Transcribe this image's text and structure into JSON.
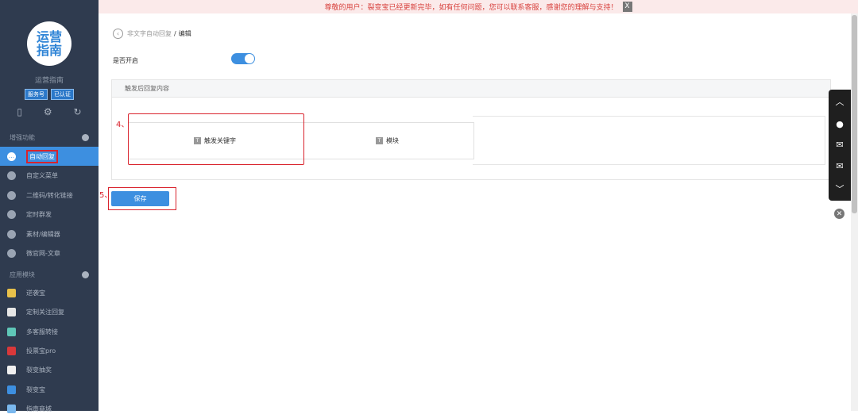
{
  "notice": {
    "text": "尊敬的用户：裂变宝已经更新完毕，如有任何问题，您可以联系客服，感谢您的理解与支持！",
    "close": "X"
  },
  "sidebar": {
    "logo_line1": "运营",
    "logo_line2": "指南",
    "account_name": "运营指南",
    "badges": [
      "服务号",
      "已认证"
    ],
    "section_features": "增强功能",
    "section_apps": "应用模块",
    "items": [
      {
        "label": "自动回复"
      },
      {
        "label": "自定义菜单"
      },
      {
        "label": "二维码/转化链接"
      },
      {
        "label": "定时群发"
      },
      {
        "label": "素材/编辑器"
      },
      {
        "label": "微官网-文章"
      }
    ],
    "apps": [
      {
        "label": "逆袭宝"
      },
      {
        "label": "定制关注回复"
      },
      {
        "label": "多客服转接"
      },
      {
        "label": "投票宝pro"
      },
      {
        "label": "裂变抽奖"
      },
      {
        "label": "裂变宝"
      },
      {
        "label": "指南商城"
      }
    ]
  },
  "breadcrumb": {
    "parent": "非文字自动回复",
    "sep": "/",
    "current": "编辑"
  },
  "form": {
    "enable_label": "是否开启",
    "panel_title": "触发后回复内容",
    "tab_keyword": "触发关键字",
    "tab_module": "模块",
    "save_label": "保存"
  },
  "annotations": {
    "step4": "4、",
    "step5": "5、"
  },
  "colors": {
    "accent": "#3d8fe0",
    "sidebar": "#2f3b4f",
    "highlight": "#d9232d"
  }
}
